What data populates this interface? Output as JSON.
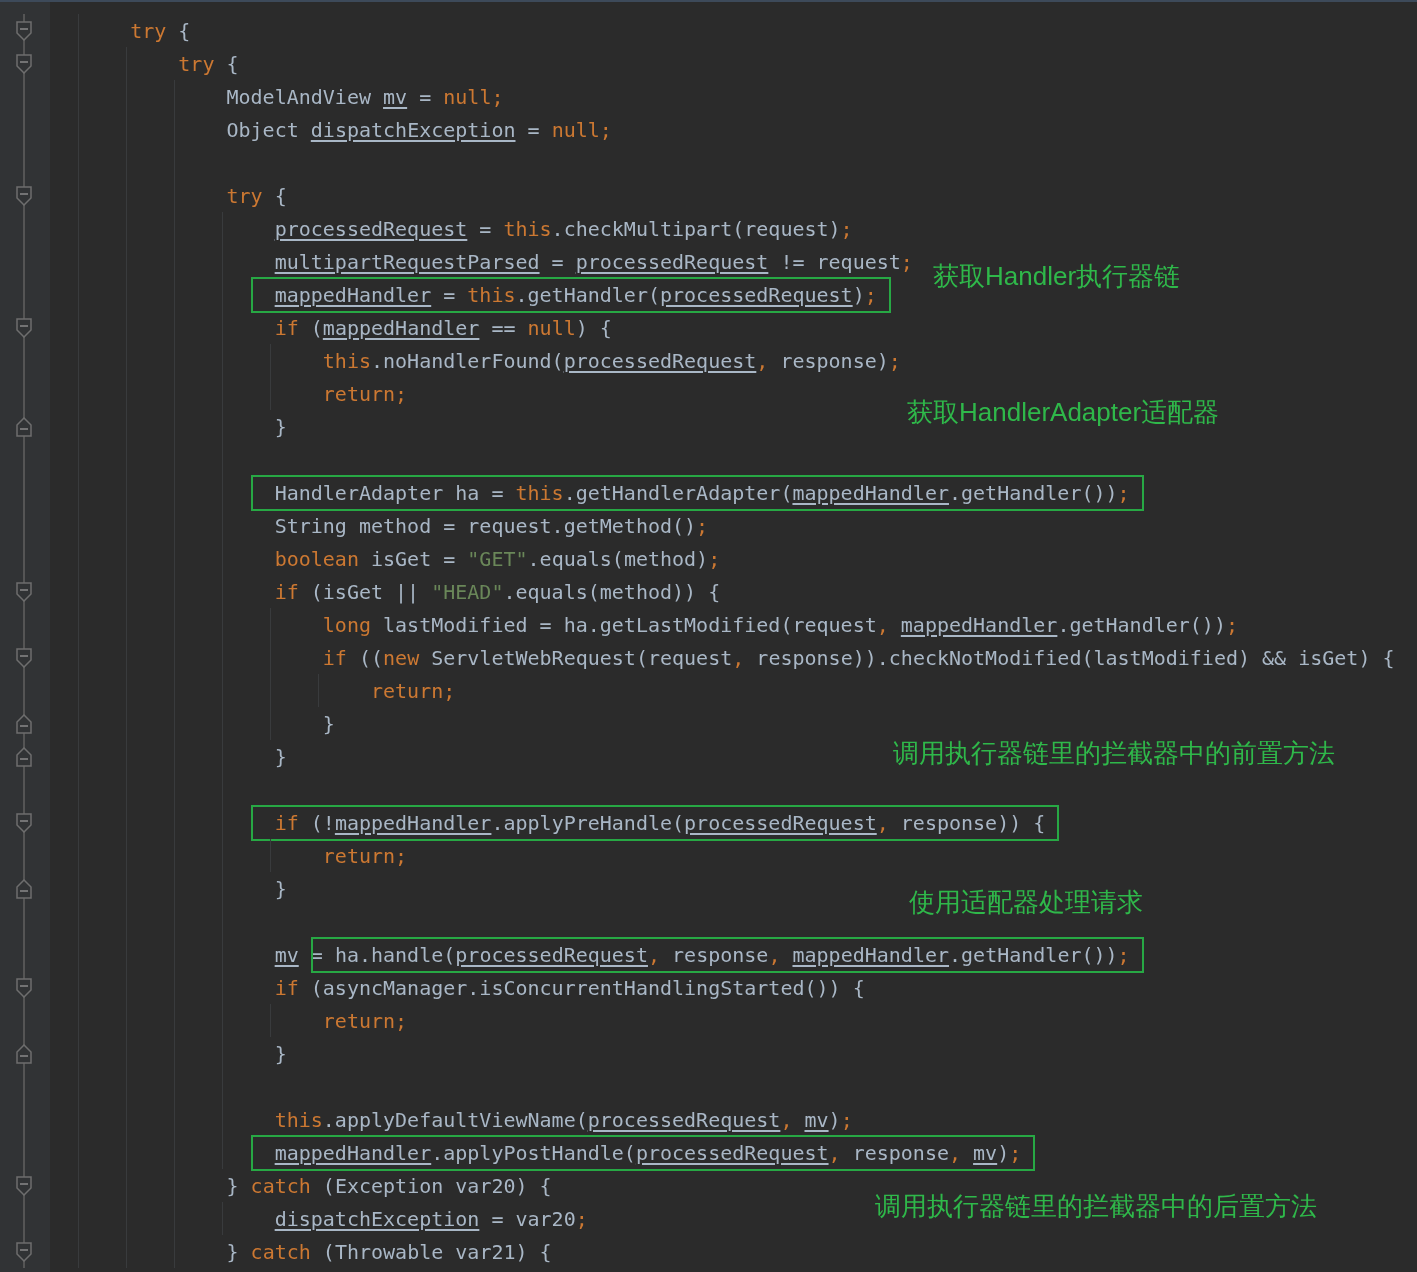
{
  "editor": {
    "lines": [
      {
        "fold": {
          "kind": "start"
        },
        "tokens": [
          {
            "text": "    try",
            "kind": "keyword"
          },
          {
            "text": " {",
            "kind": "plain"
          }
        ]
      },
      {
        "fold": {
          "kind": "start"
        },
        "tokens": [
          {
            "text": "        try",
            "kind": "keyword"
          },
          {
            "text": " {",
            "kind": "plain"
          }
        ]
      },
      {
        "tokens": [
          {
            "text": "            ModelAndView ",
            "kind": "plain"
          },
          {
            "text": "mv",
            "kind": "field"
          },
          {
            "text": " = ",
            "kind": "plain"
          },
          {
            "text": "null;",
            "kind": "keyword"
          }
        ]
      },
      {
        "tokens": [
          {
            "text": "            Object ",
            "kind": "plain"
          },
          {
            "text": "dispatchException",
            "kind": "field"
          },
          {
            "text": " = ",
            "kind": "plain"
          },
          {
            "text": "null;",
            "kind": "keyword"
          }
        ]
      },
      {
        "blank_line_above": true,
        "fold": {
          "kind": "start"
        },
        "tokens": [
          {
            "text": "            try",
            "kind": "keyword"
          },
          {
            "text": " {",
            "kind": "plain"
          }
        ]
      },
      {
        "tokens": [
          {
            "text": "                processedRequest",
            "kind": "field"
          },
          {
            "text": " = ",
            "kind": "plain"
          },
          {
            "text": "this",
            "kind": "keyword"
          },
          {
            "text": ".checkMultipart(request)",
            "kind": "plain"
          },
          {
            "text": ";",
            "kind": "keyword"
          }
        ]
      },
      {
        "tokens": [
          {
            "text": "                multipartRequestParsed",
            "kind": "field"
          },
          {
            "text": " = ",
            "kind": "plain"
          },
          {
            "text": "processedRequest",
            "kind": "field"
          },
          {
            "text": " != request",
            "kind": "plain"
          },
          {
            "text": ";",
            "kind": "keyword"
          }
        ]
      },
      {
        "note": "获取Handler执行器链",
        "tokens": [
          {
            "text": "                mappedHandler",
            "kind": "field",
            "boxed": true
          },
          {
            "text": " = ",
            "kind": "plain",
            "boxed": true
          },
          {
            "text": "this",
            "kind": "keyword",
            "boxed": true
          },
          {
            "text": ".getHandler(",
            "kind": "plain",
            "boxed": true
          },
          {
            "text": "processedRequest",
            "kind": "field",
            "boxed": true
          },
          {
            "text": ")",
            "kind": "plain",
            "boxed": true
          },
          {
            "text": ";",
            "kind": "keyword",
            "boxed": true
          }
        ]
      },
      {
        "fold": {
          "kind": "start"
        },
        "tokens": [
          {
            "text": "                if",
            "kind": "keyword"
          },
          {
            "text": " (",
            "kind": "plain"
          },
          {
            "text": "mappedHandler",
            "kind": "field"
          },
          {
            "text": " == ",
            "kind": "plain"
          },
          {
            "text": "null",
            "kind": "keyword"
          },
          {
            "text": ") {",
            "kind": "plain"
          }
        ]
      },
      {
        "tokens": [
          {
            "text": "                    this",
            "kind": "keyword"
          },
          {
            "text": ".noHandlerFound(",
            "kind": "plain"
          },
          {
            "text": "processedRequest",
            "kind": "field"
          },
          {
            "text": ", ",
            "kind": "keyword"
          },
          {
            "text": "response)",
            "kind": "plain"
          },
          {
            "text": ";",
            "kind": "keyword"
          }
        ]
      },
      {
        "tokens": [
          {
            "text": "                    return;",
            "kind": "keyword"
          }
        ]
      },
      {
        "fold": {
          "kind": "end"
        },
        "note": "获取HandlerAdapter适配器",
        "tokens": [
          {
            "text": "                }",
            "kind": "plain"
          }
        ]
      },
      {
        "blank_line_above": true,
        "tokens": [
          {
            "text": "                HandlerAdapter ha = ",
            "kind": "plain",
            "boxed": true
          },
          {
            "text": "this",
            "kind": "keyword",
            "boxed": true
          },
          {
            "text": ".getHandlerAdapter(",
            "kind": "plain",
            "boxed": true
          },
          {
            "text": "mappedHandler",
            "kind": "field",
            "boxed": true
          },
          {
            "text": ".getHandler())",
            "kind": "plain",
            "boxed": true
          },
          {
            "text": ";",
            "kind": "keyword",
            "boxed": true
          }
        ]
      },
      {
        "tokens": [
          {
            "text": "                String method = request.getMethod()",
            "kind": "plain"
          },
          {
            "text": ";",
            "kind": "keyword"
          }
        ]
      },
      {
        "tokens": [
          {
            "text": "                boolean",
            "kind": "keyword"
          },
          {
            "text": " isGet = ",
            "kind": "plain"
          },
          {
            "text": "\"GET\"",
            "kind": "string"
          },
          {
            "text": ".equals(method)",
            "kind": "plain"
          },
          {
            "text": ";",
            "kind": "keyword"
          }
        ]
      },
      {
        "fold": {
          "kind": "start"
        },
        "tokens": [
          {
            "text": "                if",
            "kind": "keyword"
          },
          {
            "text": " (isGet || ",
            "kind": "plain"
          },
          {
            "text": "\"HEAD\"",
            "kind": "string"
          },
          {
            "text": ".equals(method)) {",
            "kind": "plain"
          }
        ]
      },
      {
        "tokens": [
          {
            "text": "                    long",
            "kind": "keyword"
          },
          {
            "text": " lastModified = ha.getLastModified(request",
            "kind": "plain"
          },
          {
            "text": ", ",
            "kind": "keyword"
          },
          {
            "text": "mappedHandler",
            "kind": "field"
          },
          {
            "text": ".getHandler())",
            "kind": "plain"
          },
          {
            "text": ";",
            "kind": "keyword"
          }
        ]
      },
      {
        "fold": {
          "kind": "start"
        },
        "tokens": [
          {
            "text": "                    if",
            "kind": "keyword"
          },
          {
            "text": " ((",
            "kind": "plain"
          },
          {
            "text": "new",
            "kind": "keyword"
          },
          {
            "text": " ServletWebRequest(request",
            "kind": "plain"
          },
          {
            "text": ", ",
            "kind": "keyword"
          },
          {
            "text": "response)).checkNotModified(lastModified) && isGet) {",
            "kind": "plain"
          }
        ]
      },
      {
        "tokens": [
          {
            "text": "                        return;",
            "kind": "keyword"
          }
        ]
      },
      {
        "fold": {
          "kind": "end"
        },
        "tokens": [
          {
            "text": "                    }",
            "kind": "plain"
          }
        ]
      },
      {
        "fold": {
          "kind": "end"
        },
        "note": "调用执行器链里的拦截器中的前置方法",
        "tokens": [
          {
            "text": "                }",
            "kind": "plain"
          }
        ]
      },
      {
        "blank_line_above": true,
        "fold": {
          "kind": "start"
        },
        "tokens": [
          {
            "text": "                if",
            "kind": "keyword",
            "boxed": true
          },
          {
            "text": " (!",
            "kind": "plain",
            "boxed": true
          },
          {
            "text": "mappedHandler",
            "kind": "field",
            "boxed": true
          },
          {
            "text": ".applyPreHandle(",
            "kind": "plain",
            "boxed": true
          },
          {
            "text": "processedRequest",
            "kind": "field",
            "boxed": true
          },
          {
            "text": ", ",
            "kind": "keyword",
            "boxed": true
          },
          {
            "text": "response)) {",
            "kind": "plain",
            "boxed": true
          }
        ]
      },
      {
        "tokens": [
          {
            "text": "                    return;",
            "kind": "keyword"
          }
        ]
      },
      {
        "fold": {
          "kind": "end"
        },
        "note": "使用适配器处理请求",
        "tokens": [
          {
            "text": "                }",
            "kind": "plain"
          }
        ]
      },
      {
        "blank_line_above": true,
        "tokens": [
          {
            "text": "                mv",
            "kind": "field"
          },
          {
            "text": " = ",
            "kind": "plain"
          },
          {
            "text": "ha.handle(",
            "kind": "plain",
            "boxed": true
          },
          {
            "text": "processedRequest",
            "kind": "field",
            "boxed": true
          },
          {
            "text": ", ",
            "kind": "keyword",
            "boxed": true
          },
          {
            "text": "response",
            "kind": "plain",
            "boxed": true
          },
          {
            "text": ", ",
            "kind": "keyword",
            "boxed": true
          },
          {
            "text": "mappedHandler",
            "kind": "field",
            "boxed": true
          },
          {
            "text": ".getHandler())",
            "kind": "plain",
            "boxed": true
          },
          {
            "text": ";",
            "kind": "keyword",
            "boxed": true
          }
        ]
      },
      {
        "fold": {
          "kind": "start"
        },
        "tokens": [
          {
            "text": "                if",
            "kind": "keyword"
          },
          {
            "text": " (asyncManager.isConcurrentHandlingStarted()) {",
            "kind": "plain"
          }
        ]
      },
      {
        "tokens": [
          {
            "text": "                    return;",
            "kind": "keyword"
          }
        ]
      },
      {
        "fold": {
          "kind": "end"
        },
        "tokens": [
          {
            "text": "                }",
            "kind": "plain"
          }
        ]
      },
      {
        "blank_line_above": true,
        "tokens": [
          {
            "text": "                this",
            "kind": "keyword"
          },
          {
            "text": ".applyDefaultViewName(",
            "kind": "plain"
          },
          {
            "text": "processedRequest",
            "kind": "field"
          },
          {
            "text": ", ",
            "kind": "keyword"
          },
          {
            "text": "mv",
            "kind": "field"
          },
          {
            "text": ")",
            "kind": "plain"
          },
          {
            "text": ";",
            "kind": "keyword"
          }
        ]
      },
      {
        "tokens": [
          {
            "text": "                mappedHandler",
            "kind": "field",
            "boxed": true
          },
          {
            "text": ".applyPostHandle(",
            "kind": "plain",
            "boxed": true
          },
          {
            "text": "processedRequest",
            "kind": "field",
            "boxed": true
          },
          {
            "text": ", ",
            "kind": "keyword",
            "boxed": true
          },
          {
            "text": "response",
            "kind": "plain",
            "boxed": true
          },
          {
            "text": ", ",
            "kind": "keyword",
            "boxed": true
          },
          {
            "text": "mv",
            "kind": "field",
            "boxed": true
          },
          {
            "text": ")",
            "kind": "plain",
            "boxed": true
          },
          {
            "text": ";",
            "kind": "keyword",
            "boxed": true
          }
        ]
      },
      {
        "fold": {
          "kind": "start"
        },
        "tokens": [
          {
            "text": "            } ",
            "kind": "plain"
          },
          {
            "text": "catch",
            "kind": "keyword"
          },
          {
            "text": " (Exception var20) {",
            "kind": "plain"
          }
        ]
      },
      {
        "note": "调用执行器链里的拦截器中的后置方法",
        "tokens": [
          {
            "text": "                dispatchException",
            "kind": "field"
          },
          {
            "text": " = var20",
            "kind": "plain"
          },
          {
            "text": ";",
            "kind": "keyword"
          }
        ]
      },
      {
        "fold": {
          "kind": "start"
        },
        "tokens": [
          {
            "text": "            } ",
            "kind": "plain"
          },
          {
            "text": "catch",
            "kind": "keyword"
          },
          {
            "text": " (Throwable var21) {",
            "kind": "plain"
          }
        ]
      }
    ]
  }
}
